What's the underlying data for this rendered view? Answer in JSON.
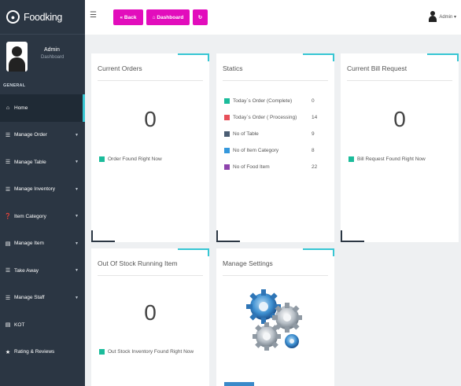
{
  "brand": {
    "name": "Foodking",
    "icon": "paw-icon"
  },
  "profile": {
    "name": "Admin",
    "role": "Dashboard",
    "section": "GENERAL"
  },
  "menu": [
    {
      "label": "Home",
      "icon": "home-icon",
      "chev": ""
    },
    {
      "label": "Manage Order",
      "icon": "list-icon",
      "chev": "▼"
    },
    {
      "label": "Manage Table",
      "icon": "list-icon",
      "chev": "▼"
    },
    {
      "label": "Manage Inventory",
      "icon": "list-icon",
      "chev": "▼"
    },
    {
      "label": "Item Category",
      "icon": "question-icon",
      "chev": "▼"
    },
    {
      "label": "Manage Item",
      "icon": "doc-icon",
      "chev": "▼"
    },
    {
      "label": "Take Away",
      "icon": "list-icon",
      "chev": "▼"
    },
    {
      "label": "Manage Staff",
      "icon": "list-icon",
      "chev": "▼"
    },
    {
      "label": "KOT",
      "icon": "doc-icon",
      "chev": ""
    },
    {
      "label": "Rating & Reviews",
      "icon": "star-icon",
      "chev": ""
    }
  ],
  "topbar": {
    "back": "« Back",
    "dashboard": "⌂ Dashboard",
    "refresh": "↻",
    "user": "Admin ▾"
  },
  "cards": {
    "orders": {
      "title": "Current Orders",
      "value": "0",
      "note": "Order Found Right Now",
      "note_color": "#1bbc9b"
    },
    "statics": {
      "title": "Statics",
      "rows": [
        {
          "label": "Today`s Order (Complete)",
          "value": "0",
          "color": "#1bbc9b"
        },
        {
          "label": "Today`s Order ( Processing)",
          "value": "14",
          "color": "#e7505a"
        },
        {
          "label": "No of Table",
          "value": "9",
          "color": "#4b5d73"
        },
        {
          "label": "No of Item Category",
          "value": "8",
          "color": "#3598dc"
        },
        {
          "label": "No of Food Item",
          "value": "22",
          "color": "#8e44ad"
        }
      ]
    },
    "bill": {
      "title": "Current Bill Request",
      "value": "0",
      "note": "Bill Request Found Right Now",
      "note_color": "#1bbc9b"
    },
    "stock": {
      "title": "Out Of Stock Running Item",
      "value": "0",
      "note": "Out Stock Inventory Found Right Now",
      "note_color": "#1bbc9b"
    },
    "settings": {
      "title": "Manage Settings",
      "image": "gears-icon"
    }
  },
  "colors": {
    "accent": "#36c6d3",
    "button": "#e20dbc",
    "sidebar": "#2b3643"
  }
}
